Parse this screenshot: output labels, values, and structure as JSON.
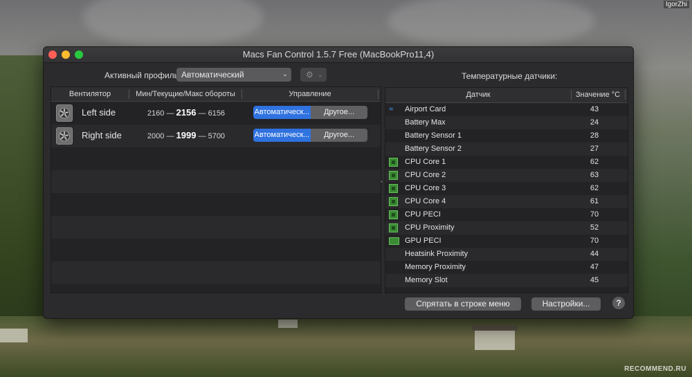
{
  "watermark": {
    "user": "IgorZhi",
    "site": "RECOMMEND.RU"
  },
  "window": {
    "title": "Macs Fan Control 1.5.7 Free (MacBookPro11,4)"
  },
  "profile": {
    "label": "Активный профиль:",
    "value": "Автоматический",
    "gear_icon": "gear-icon"
  },
  "fans": {
    "columns": [
      "Вентилятор",
      "Мин/Текущие/Макс обороты",
      "Управление"
    ],
    "rows": [
      {
        "name": "Left side",
        "min": "2160",
        "current": "2156",
        "max": "6156",
        "auto_label": "Автоматическ...",
        "other_label": "Другое..."
      },
      {
        "name": "Right side",
        "min": "2000",
        "current": "1999",
        "max": "5700",
        "auto_label": "Автоматическ...",
        "other_label": "Другое..."
      }
    ],
    "dash": "—"
  },
  "sensors": {
    "title": "Температурные датчики:",
    "columns": [
      "Датчик",
      "Значение °C"
    ],
    "rows": [
      {
        "name": "Airport Card",
        "value": "43",
        "icon": "wifi-icon"
      },
      {
        "name": "Battery Max",
        "value": "24",
        "icon": ""
      },
      {
        "name": "Battery Sensor 1",
        "value": "28",
        "icon": ""
      },
      {
        "name": "Battery Sensor 2",
        "value": "27",
        "icon": ""
      },
      {
        "name": "CPU Core 1",
        "value": "62",
        "icon": "cpu-chip-icon"
      },
      {
        "name": "CPU Core 2",
        "value": "63",
        "icon": "cpu-chip-icon"
      },
      {
        "name": "CPU Core 3",
        "value": "62",
        "icon": "cpu-chip-icon"
      },
      {
        "name": "CPU Core 4",
        "value": "61",
        "icon": "cpu-chip-icon"
      },
      {
        "name": "CPU PECI",
        "value": "70",
        "icon": "cpu-chip-icon"
      },
      {
        "name": "CPU Proximity",
        "value": "52",
        "icon": "cpu-chip-icon"
      },
      {
        "name": "GPU PECI",
        "value": "70",
        "icon": "gpu-card-icon"
      },
      {
        "name": "Heatsink Proximity",
        "value": "44",
        "icon": ""
      },
      {
        "name": "Memory Proximity",
        "value": "47",
        "icon": ""
      },
      {
        "name": "Memory Slot",
        "value": "45",
        "icon": ""
      }
    ]
  },
  "footer": {
    "hide_menu_label": "Спрятать в строке меню",
    "settings_label": "Настройки...",
    "help_label": "?"
  },
  "colors": {
    "accent": "#2f72e0",
    "chip": "#3b8a35",
    "wifi": "#4aa3ff"
  }
}
